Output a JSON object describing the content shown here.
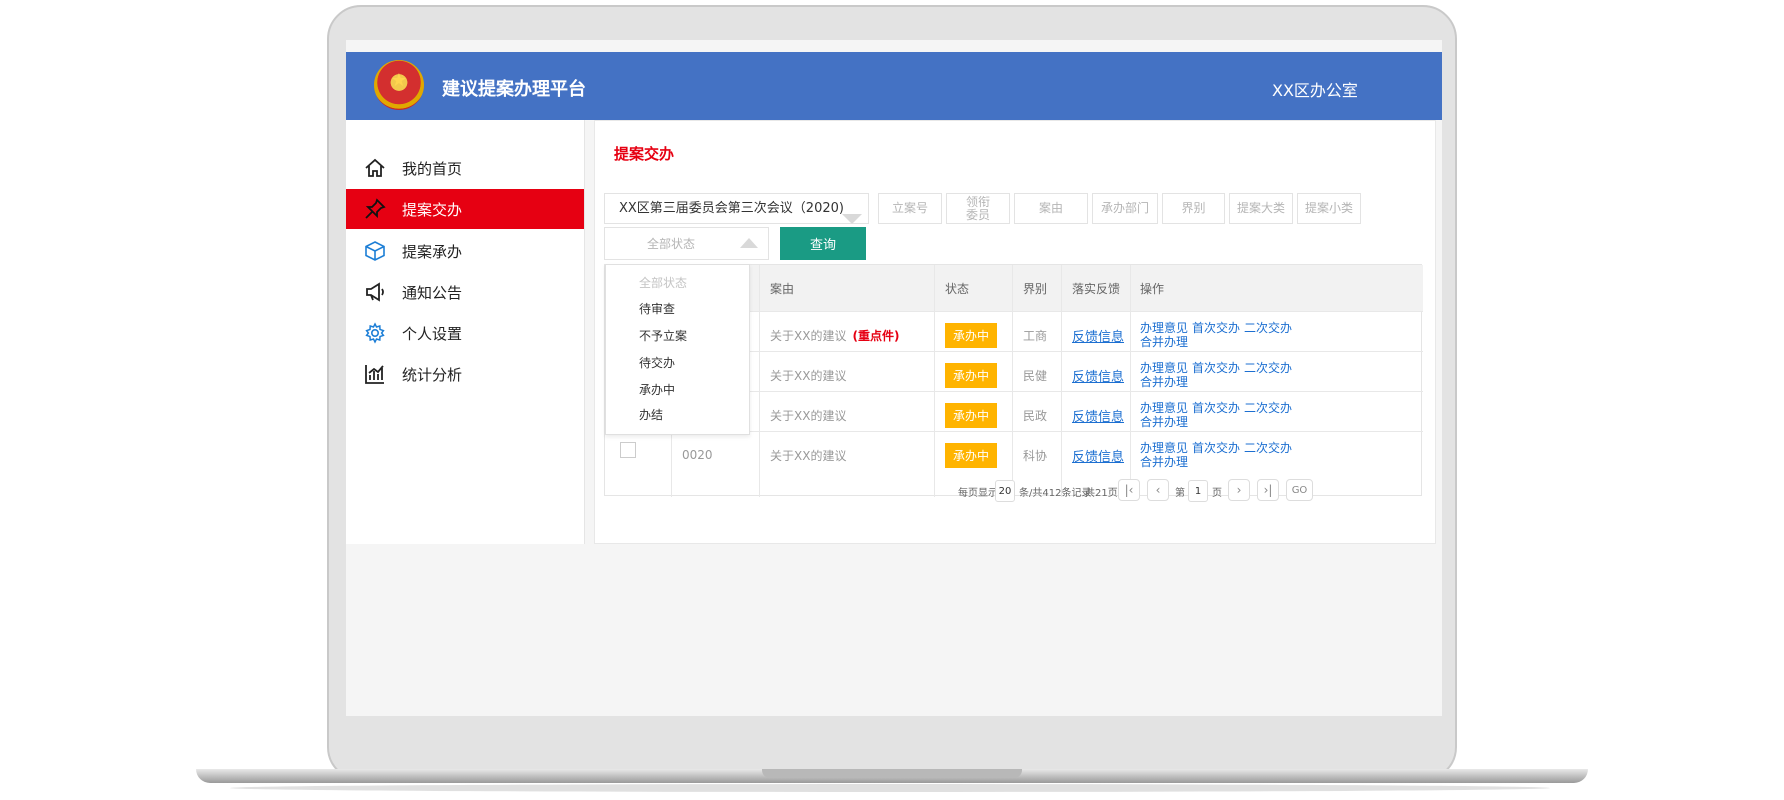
{
  "header": {
    "title": "建议提案办理平台",
    "org": "XX区办公室"
  },
  "sidebar": {
    "items": [
      {
        "label": "我的首页",
        "icon": "home-icon"
      },
      {
        "label": "提案交办",
        "icon": "pin-icon"
      },
      {
        "label": "提案承办",
        "icon": "cube-icon"
      },
      {
        "label": "通知公告",
        "icon": "megaphone-icon"
      },
      {
        "label": "个人设置",
        "icon": "gear-icon"
      },
      {
        "label": "统计分析",
        "icon": "chart-icon"
      }
    ]
  },
  "main": {
    "page_title": "提案交办",
    "filters": {
      "meeting": "XX区第三届委员会第三次会议（2020)",
      "fields": [
        "立案号",
        "领衔委员",
        "案由",
        "承办部门",
        "界别",
        "提案大类",
        "提案小类"
      ],
      "status_placeholder": "全部状态",
      "query_label": "查询"
    },
    "status_dropdown": [
      "全部状态",
      "待审查",
      "不予立案",
      "待交办",
      "承办中",
      "办结"
    ],
    "table": {
      "headers": {
        "reason": "案由",
        "status": "状态",
        "sector": "界别",
        "feedback": "落实反馈",
        "actions": "操作"
      },
      "rows": [
        {
          "id": "",
          "reason": "关于XX的建议",
          "key_tag": "(重点件)",
          "status": "承办中",
          "sector": "工商",
          "feedback": "反馈信息"
        },
        {
          "id": "",
          "reason": "关于XX的建议",
          "key_tag": "",
          "status": "承办中",
          "sector": "民健",
          "feedback": "反馈信息"
        },
        {
          "id": "",
          "reason": "关于XX的建议",
          "key_tag": "",
          "status": "承办中",
          "sector": "民政",
          "feedback": "反馈信息"
        },
        {
          "id": "0020",
          "reason": "关于XX的建议",
          "key_tag": "",
          "status": "承办中",
          "sector": "科协",
          "feedback": "反馈信息"
        }
      ],
      "actions": {
        "a1": "办理意见",
        "a2": "首次交办",
        "a3": "二次交办",
        "a4": "合并办理"
      }
    },
    "pagination": {
      "per_page_label": "每页显示",
      "per_page": "20",
      "records": "条/共412条记录",
      "total_pages": "共21页",
      "page_prefix": "第",
      "current_page": "1",
      "page_suffix": "页",
      "go_label": "GO"
    }
  }
}
